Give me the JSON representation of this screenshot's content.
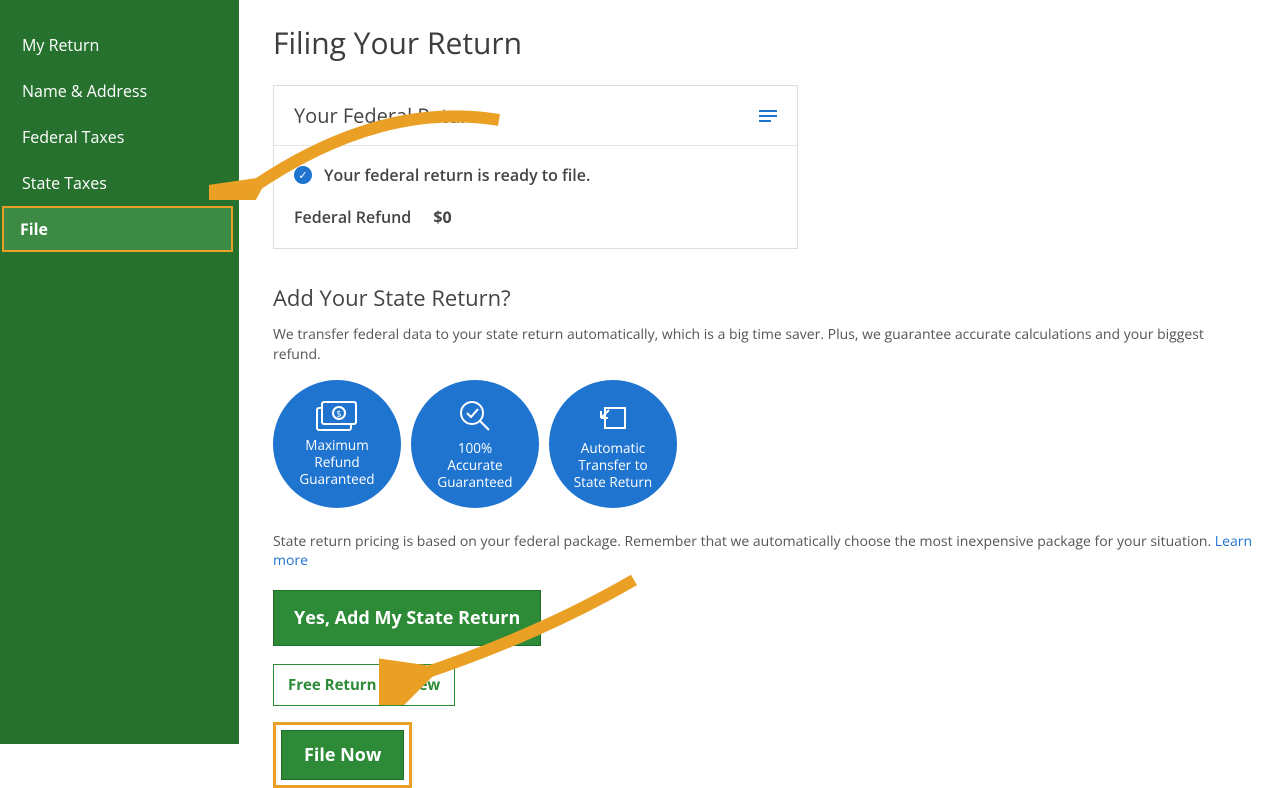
{
  "sidebar": {
    "items": [
      {
        "label": "My Return"
      },
      {
        "label": "Name & Address"
      },
      {
        "label": "Federal Taxes"
      },
      {
        "label": "State Taxes"
      },
      {
        "label": "File"
      }
    ]
  },
  "page": {
    "title": "Filing Your Return"
  },
  "card": {
    "header": "Your Federal Return",
    "status": "Your federal return is ready to file.",
    "refund_label": "Federal Refund",
    "refund_amount": "$0"
  },
  "state_section": {
    "title": "Add Your State Return?",
    "intro": "We transfer federal data to your state return automatically, which is a big time saver. Plus, we guarantee accurate calculations and your biggest refund.",
    "circles": [
      {
        "line1": "Maximum",
        "line2": "Refund",
        "line3": "Guaranteed"
      },
      {
        "line1": "100%",
        "line2": "Accurate",
        "line3": "Guaranteed"
      },
      {
        "line1": "Automatic",
        "line2": "Transfer to",
        "line3": "State Return"
      }
    ],
    "pricing": "State return pricing is based on your federal package. Remember that we automatically choose the most inexpensive package for your situation. ",
    "learn_more": "Learn more"
  },
  "buttons": {
    "add_state": "Yes, Add My State Return",
    "free_preview": "Free Return Preview",
    "file_now": "File Now"
  }
}
